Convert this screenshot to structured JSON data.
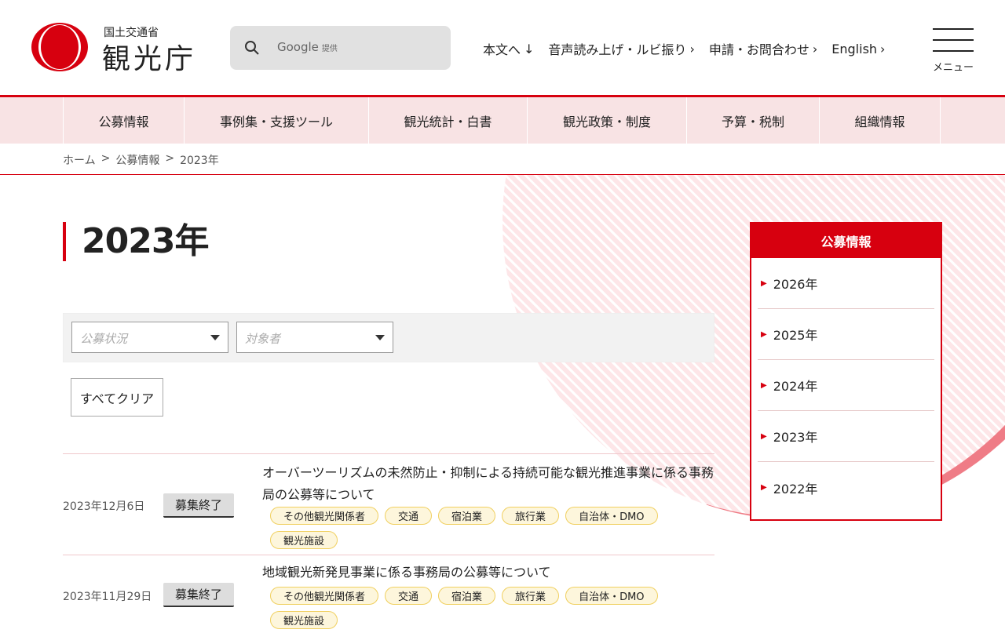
{
  "header": {
    "logo_small": "国土交通省",
    "logo_big": "観光庁",
    "search_placeholder": "Google",
    "search_provided": "提供",
    "links": [
      "本文へ",
      "音声読み上げ・ルビ振り",
      "申請・お問合わせ",
      "English"
    ],
    "menu_label": "メニュー"
  },
  "nav": [
    "公募情報",
    "事例集・支援ツール",
    "観光統計・白書",
    "観光政策・制度",
    "予算・税制",
    "組織情報"
  ],
  "breadcrumb": [
    "ホーム",
    "公募情報",
    "2023年"
  ],
  "page_title": "2023年",
  "filters": {
    "status_placeholder": "公募状況",
    "target_placeholder": "対象者",
    "clear_label": "すべてクリア"
  },
  "items": [
    {
      "date": "2023年12月6日",
      "status": "募集終了",
      "title": "オーバーツーリズムの未然防止・抑制による持続可能な観光推進事業に係る事務局の公募等について",
      "tags": [
        "その他観光関係者",
        "交通",
        "宿泊業",
        "旅行業",
        "自治体・DMO",
        "観光施設"
      ]
    },
    {
      "date": "2023年11月29日",
      "status": "募集終了",
      "title": "地域観光新発見事業に係る事務局の公募等について",
      "tags": [
        "その他観光関係者",
        "交通",
        "宿泊業",
        "旅行業",
        "自治体・DMO",
        "観光施設"
      ]
    }
  ],
  "sidebar": {
    "title": "公募情報",
    "items": [
      "2026年",
      "2025年",
      "2024年",
      "2023年",
      "2022年"
    ]
  },
  "colors": {
    "accent": "#d7000f",
    "nav_bg": "#f8e3e4"
  }
}
